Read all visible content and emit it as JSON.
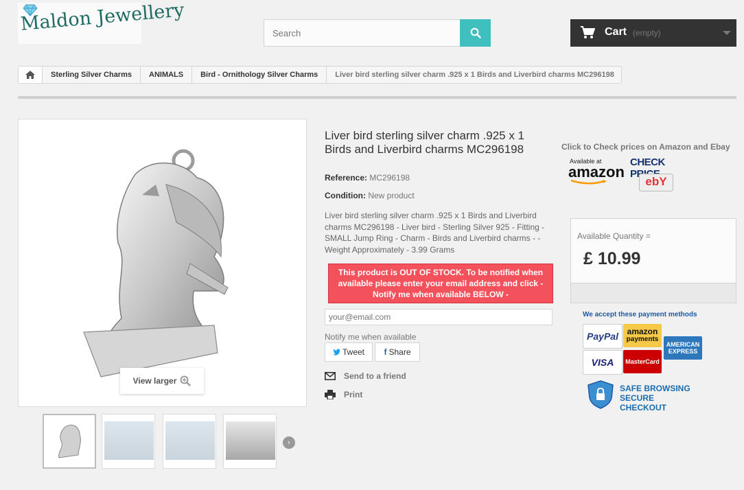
{
  "header": {
    "logo_text": "Maldon Jewellery",
    "search_placeholder": "Search",
    "cart_label": "Cart",
    "cart_status": "(empty)"
  },
  "breadcrumb": {
    "items": [
      "Sterling Silver Charms",
      "ANIMALS",
      "Bird - Ornithology Silver Charms"
    ],
    "current": "Liver bird sterling silver charm .925 x 1 Birds and Liverbird charms MC296198"
  },
  "product": {
    "title": "Liver bird sterling silver charm .925 x 1 Birds and Liverbird charms MC296198",
    "reference_label": "Reference:",
    "reference_value": "MC296198",
    "condition_label": "Condition:",
    "condition_value": "New product",
    "description": "Liver bird sterling silver charm .925 x 1 Birds and Liverbird charms MC296198 - Liver bird - Sterling Silver 925 - Fitting - SMALL Jump Ring - Charm - Birds and Liverbird charms - - Weight Approximately - 3.99 Grams",
    "out_of_stock_message": "This product is OUT OF STOCK. To be notified when available please enter your email address and click - Notify me when available BELOW -",
    "email_placeholder": "your@email.com",
    "notify_label": "Notify me when available",
    "tweet_label": "Tweet",
    "share_label": "Share",
    "send_friend_label": "Send to a friend",
    "print_label": "Print",
    "view_larger_label": "View larger"
  },
  "sidebar": {
    "check_prices_label": "Click to Check prices on Amazon and Ebay",
    "amazon_available_text": "Available at",
    "amazon_brand": "amazon",
    "check_price_text": "CHECK PRICE",
    "ebay_text": "ebY",
    "availability_label": "Available Quantity =",
    "price": "£ 10.99",
    "payment_title": "We accept these payment methods",
    "payment_methods": [
      "PayPal",
      "amazon",
      "payments",
      "AMERICAN",
      "EXPRESS",
      "VISA",
      "MasterCard"
    ],
    "safe_browsing_line1": "SAFE BROWSING",
    "safe_browsing_line2": "SECURE CHECKOUT"
  },
  "colors": {
    "accent": "#3fbfbd",
    "cart_bg": "#333333",
    "out_of_stock": "#f3515c",
    "logo": "#1d6b63"
  }
}
